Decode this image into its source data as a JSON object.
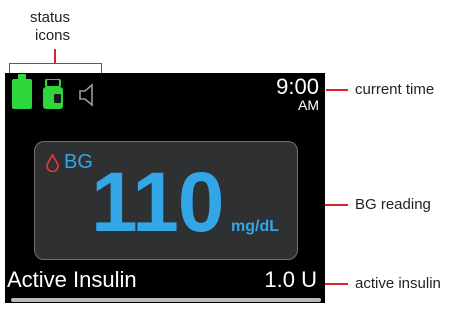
{
  "callouts": {
    "status_icons": "status\nicons",
    "status_icons_line1": "status",
    "status_icons_line2": "icons",
    "current_time": "current time",
    "bg_reading": "BG reading",
    "active_insulin": "active insulin",
    "line_color": "#d9232f"
  },
  "screen": {
    "status": {
      "icons": [
        "battery-icon",
        "pod-icon",
        "speaker-muted-icon"
      ],
      "battery_color": "#2fd83a"
    },
    "time": {
      "value": "9:00",
      "ampm": "AM"
    },
    "bg": {
      "label": "BG",
      "value": "110",
      "unit": "mg/dL",
      "accent_color": "#32a6e6",
      "drop_color": "#e0343a"
    },
    "insulin": {
      "label": "Active Insulin",
      "value": "1.0 U"
    }
  }
}
